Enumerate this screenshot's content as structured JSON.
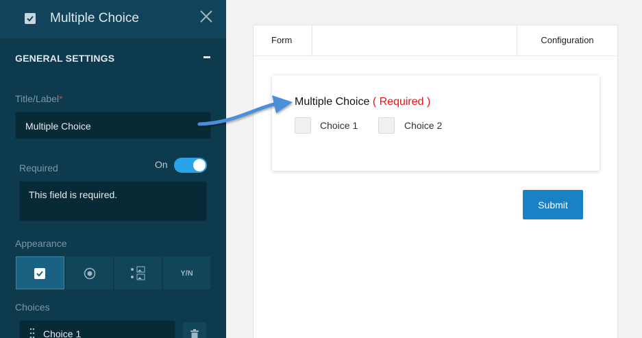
{
  "sidebar": {
    "header_title": "Multiple Choice",
    "section_title": "GENERAL SETTINGS",
    "title_label": "Title/Label",
    "required_marker": "*",
    "title_value": "Multiple Choice",
    "required_label": "Required",
    "toggle_label": "On",
    "required_message": "This field is required.",
    "appearance_label": "Appearance",
    "appearance_options": [
      {
        "icon": "checkbox-icon",
        "active": true
      },
      {
        "icon": "radio-icon",
        "active": false
      },
      {
        "icon": "image-choice-icon",
        "active": false
      },
      {
        "label": "Y/N",
        "active": false
      }
    ],
    "choices_label": "Choices",
    "choice_items": [
      "Choice 1"
    ]
  },
  "tabs": {
    "form": "Form",
    "configuration": "Configuration"
  },
  "preview": {
    "question_title": "Multiple Choice",
    "required_text": "( Required )",
    "choices": [
      "Choice 1",
      "Choice 2"
    ],
    "submit_label": "Submit"
  },
  "colors": {
    "sidebar_bg": "#0e3a4d",
    "accent": "#2aa3e8",
    "submit": "#1982c4",
    "required": "#e11111"
  }
}
